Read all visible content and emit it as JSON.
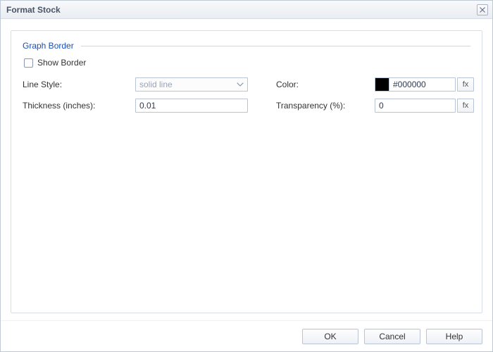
{
  "dialog": {
    "title": "Format Stock"
  },
  "section": {
    "title": "Graph Border",
    "show_border_label": "Show Border",
    "show_border_checked": false
  },
  "fields": {
    "line_style_label": "Line Style:",
    "line_style_value": "solid line",
    "thickness_label": "Thickness (inches):",
    "thickness_value": "0.01",
    "color_label": "Color:",
    "color_value": "#000000",
    "color_swatch": "#000000",
    "transparency_label": "Transparency (%):",
    "transparency_value": "0",
    "fx_label": "fx"
  },
  "buttons": {
    "ok": "OK",
    "cancel": "Cancel",
    "help": "Help"
  }
}
